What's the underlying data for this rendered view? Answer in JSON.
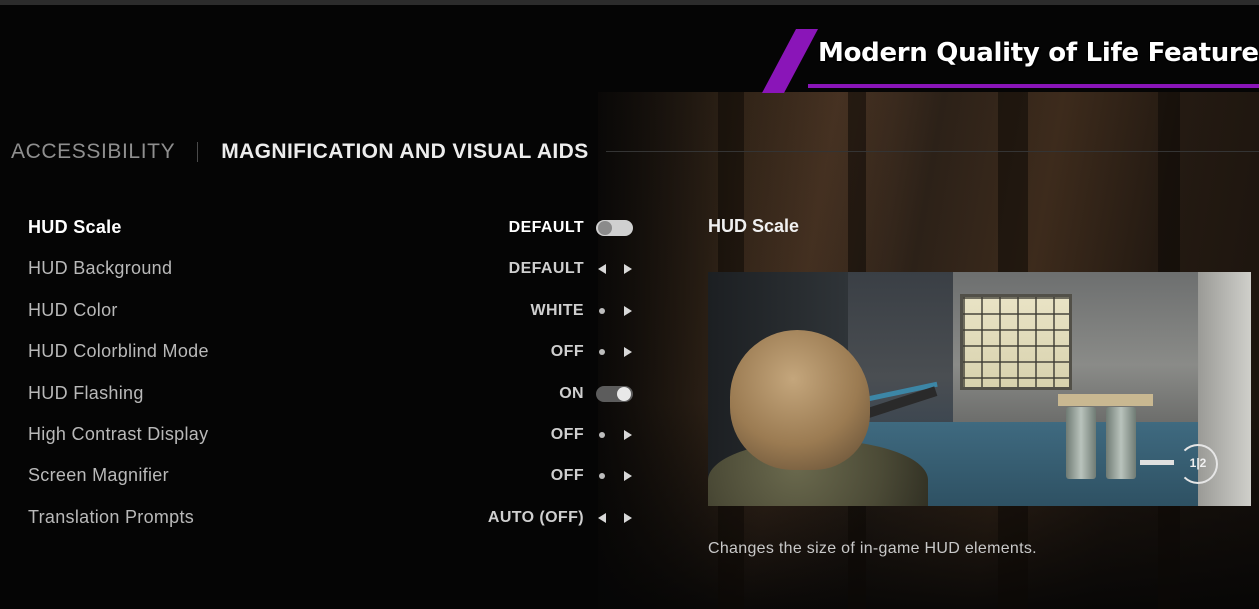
{
  "banner": {
    "text": "Modern Quality of Life Features",
    "accent_color": "#8a15b8"
  },
  "header": {
    "breadcrumb_parent": "ACCESSIBILITY",
    "breadcrumb_current": "MAGNIFICATION AND VISUAL AIDS"
  },
  "settings": {
    "items": [
      {
        "label": "HUD Scale",
        "value": "DEFAULT",
        "control": "toggle",
        "toggle_state": "off",
        "selected": true
      },
      {
        "label": "HUD Background",
        "value": "DEFAULT",
        "control": "arrows"
      },
      {
        "label": "HUD Color",
        "value": "WHITE",
        "control": "dot-arrow"
      },
      {
        "label": "HUD Colorblind Mode",
        "value": "OFF",
        "control": "dot-arrow"
      },
      {
        "label": "HUD Flashing",
        "value": "ON",
        "control": "toggle",
        "toggle_state": "on"
      },
      {
        "label": "High Contrast Display",
        "value": "OFF",
        "control": "dot-arrow"
      },
      {
        "label": "Screen Magnifier",
        "value": "OFF",
        "control": "dot-arrow"
      },
      {
        "label": "Translation Prompts",
        "value": "AUTO (OFF)",
        "control": "arrows"
      }
    ]
  },
  "detail": {
    "title": "HUD Scale",
    "preview_hud_ammo": "1|2",
    "description": "Changes the size of in-game HUD elements."
  }
}
